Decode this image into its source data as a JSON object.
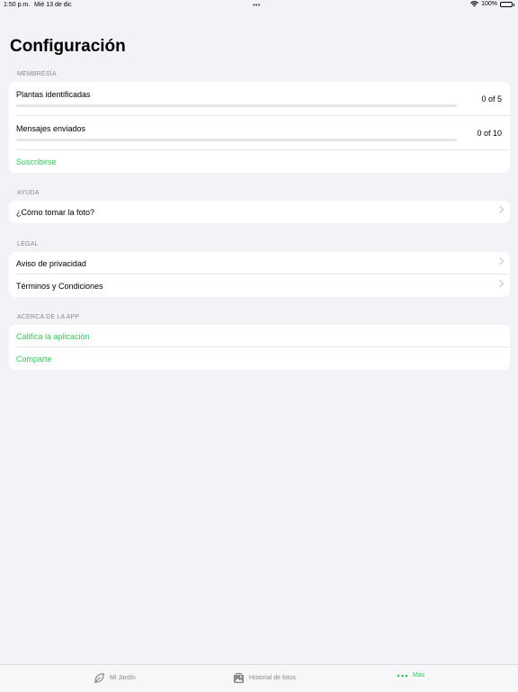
{
  "status_bar": {
    "time": "1:50 p.m.",
    "date": "Mié 13 de dic",
    "battery": "100%"
  },
  "page": {
    "title": "Configuración"
  },
  "membership": {
    "header": "MEMBRESÍA",
    "plants": {
      "label": "Plantas identificadas",
      "count": "0 of 5",
      "progress": 0
    },
    "messages": {
      "label": "Mensajes enviados",
      "count": "0 of 10",
      "progress": 0
    },
    "subscribe": "Suscribirse"
  },
  "help": {
    "header": "AYUDA",
    "photo": "¿Cómo tomar la foto?"
  },
  "legal": {
    "header": "LEGAL",
    "privacy": "Aviso de privacidad",
    "terms": "Términos y Condiciones"
  },
  "about": {
    "header": "ACERCA DE LA APP",
    "rate": "Califica la aplicación",
    "share": "Comparte"
  },
  "tabbar": {
    "garden": "Mi Jardín",
    "history": "Historial de fotos",
    "more": "Más"
  },
  "colors": {
    "accent": "#34c759",
    "background": "#f2f2f7"
  }
}
